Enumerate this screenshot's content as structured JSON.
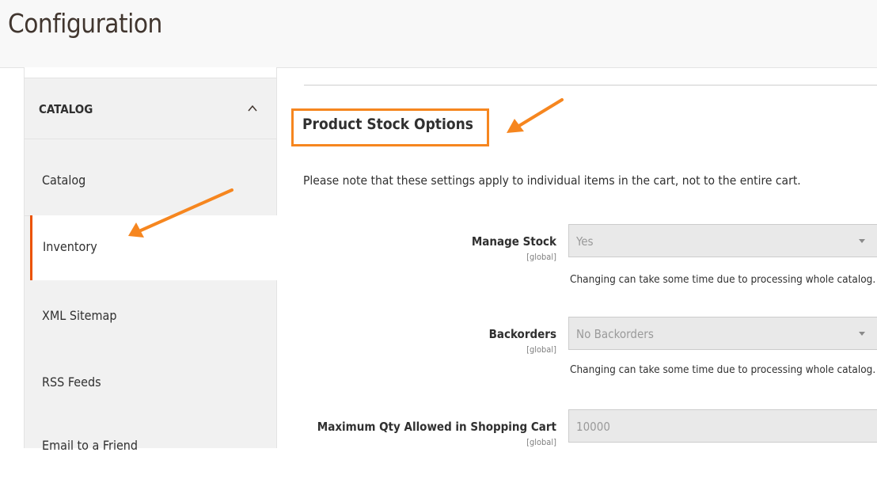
{
  "page": {
    "title": "Configuration"
  },
  "sidebar": {
    "section_title": "CATALOG",
    "items": [
      {
        "label": "Catalog"
      },
      {
        "label": "Inventory",
        "active": true
      },
      {
        "label": "XML Sitemap"
      },
      {
        "label": "RSS Feeds"
      },
      {
        "label": "Email to a Friend"
      }
    ]
  },
  "main": {
    "section_title": "Product Stock Options",
    "note": "Please note that these settings apply to individual items in the cart, not to the entire cart.",
    "fields": [
      {
        "label": "Manage Stock",
        "scope": "[global]",
        "value": "Yes",
        "hint": "Changing can take some time due to processing whole catalog."
      },
      {
        "label": "Backorders",
        "scope": "[global]",
        "value": "No Backorders",
        "hint": "Changing can take some time due to processing whole catalog."
      },
      {
        "label": "Maximum Qty Allowed in Shopping Cart",
        "scope": "[global]",
        "value": "10000"
      }
    ]
  },
  "colors": {
    "accent": "#eb5202",
    "highlight": "#f6861f"
  }
}
